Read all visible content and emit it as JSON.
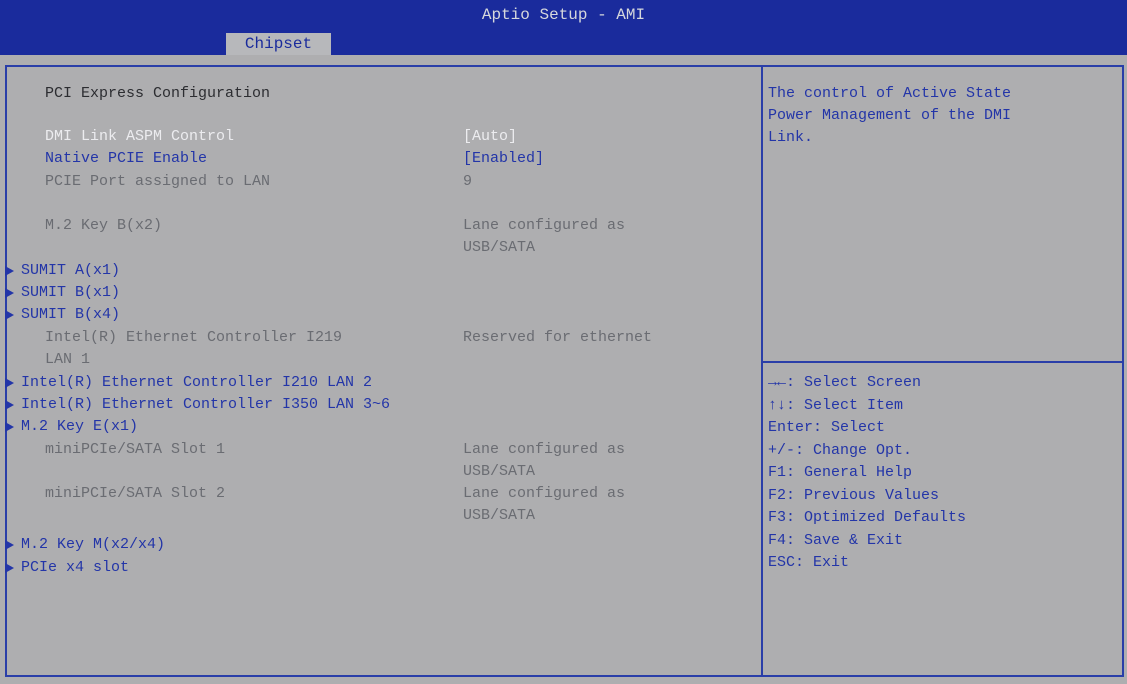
{
  "app_title": "Aptio Setup - AMI",
  "active_tab": "Chipset",
  "section_title": "PCI Express Configuration",
  "items": {
    "dmi_aspm": {
      "label": "DMI Link ASPM Control",
      "value": "[Auto]"
    },
    "native_pcie": {
      "label": "Native PCIE Enable",
      "value": "[Enabled]"
    },
    "pcie_port_lan": {
      "label": "PCIE Port assigned to LAN",
      "value": "9"
    },
    "m2_key_b": {
      "label": "M.2 Key B(x2)",
      "value_line1": "Lane configured as",
      "value_line2": "USB/SATA"
    },
    "sumit_a_x1": {
      "label": "SUMIT A(x1)"
    },
    "sumit_b_x1": {
      "label": "SUMIT B(x1)"
    },
    "sumit_b_x4": {
      "label": "SUMIT B(x4)"
    },
    "i219": {
      "label_line1": "Intel(R) Ethernet Controller I219",
      "label_line2": "LAN 1",
      "value": "Reserved for ethernet"
    },
    "i210": {
      "label": "Intel(R) Ethernet Controller I210 LAN 2"
    },
    "i350": {
      "label": "Intel(R) Ethernet Controller I350 LAN 3~6"
    },
    "m2_key_e": {
      "label": "M.2 Key E(x1)"
    },
    "minipcie_slot1": {
      "label": "miniPCIe/SATA Slot 1",
      "value_line1": "Lane configured as",
      "value_line2": "USB/SATA"
    },
    "minipcie_slot2": {
      "label": "miniPCIe/SATA Slot 2",
      "value_line1": "Lane configured as",
      "value_line2": "USB/SATA"
    },
    "m2_key_m": {
      "label": "M.2 Key M(x2/x4)"
    },
    "pcie_x4_slot": {
      "label": "PCIe x4 slot"
    }
  },
  "help": {
    "lines": [
      "The control of Active State",
      "Power Management of the DMI",
      "Link."
    ]
  },
  "keys": {
    "select_screen": "→←: Select Screen",
    "select_item": "↑↓: Select Item",
    "enter": "Enter: Select",
    "change_opt": "+/-: Change Opt.",
    "f1": "F1: General Help",
    "f2": "F2: Previous Values",
    "f3": "F3: Optimized Defaults",
    "f4": "F4: Save & Exit",
    "esc": "ESC: Exit"
  },
  "colors": {
    "header_bg": "#1a2b9c",
    "panel_bg": "#aeaeb0",
    "accent_text": "#2335a8",
    "highlight_text": "#ececef"
  }
}
